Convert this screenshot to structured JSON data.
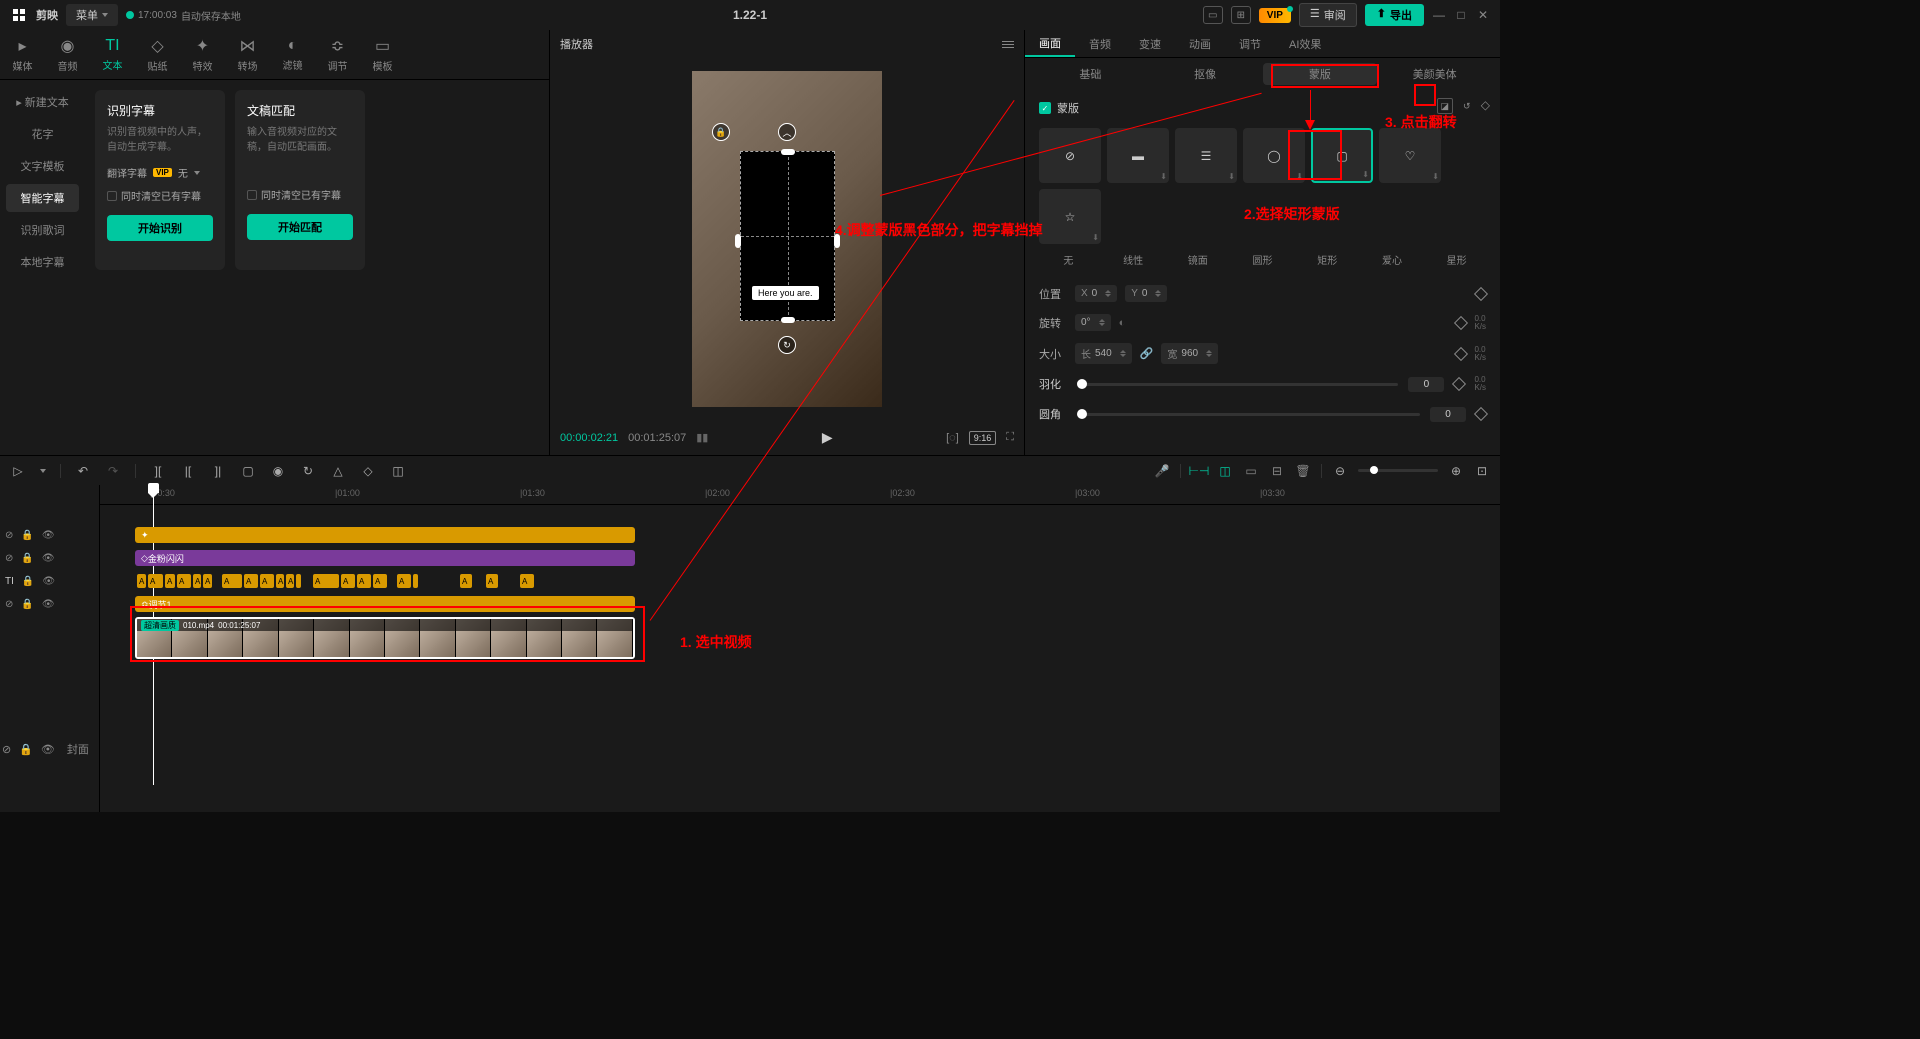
{
  "titlebar": {
    "app": "剪映",
    "menu": "菜单",
    "autosave_time": "17:00:03",
    "autosave_label": "自动保存本地",
    "project": "1.22-1",
    "vip": "VIP",
    "review": "审阅",
    "export": "导出"
  },
  "top_tabs": [
    "媒体",
    "音频",
    "文本",
    "贴纸",
    "特效",
    "转场",
    "滤镜",
    "调节",
    "模板"
  ],
  "top_tab_labels_en": [
    "TI"
  ],
  "left_sidebar": [
    "新建文本",
    "花字",
    "文字模板",
    "智能字幕",
    "识别歌词",
    "本地字幕"
  ],
  "cards": {
    "a": {
      "title": "识别字幕",
      "desc": "识别音视频中的人声，自动生成字幕。",
      "translate_label": "翻译字幕",
      "translate_value": "无",
      "clear": "同时清空已有字幕",
      "btn": "开始识别"
    },
    "b": {
      "title": "文稿匹配",
      "desc": "输入音视频对应的文稿，自动匹配画面。",
      "clear": "同时清空已有字幕",
      "btn": "开始匹配"
    }
  },
  "preview": {
    "header": "播放器",
    "subtitle": "Here you are.",
    "time_current": "00:00:02:21",
    "time_total": "00:01:25:07",
    "ratio": "9:16"
  },
  "right_tabs": [
    "画面",
    "音频",
    "变速",
    "动画",
    "调节",
    "AI效果"
  ],
  "sub_tabs": [
    "基础",
    "抠像",
    "蒙版",
    "美颜美体"
  ],
  "mask": {
    "label": "蒙版",
    "shapes": [
      "无",
      "线性",
      "镜面",
      "圆形",
      "矩形",
      "爱心",
      "星形"
    ],
    "position_label": "位置",
    "position_x": "0",
    "position_y": "0",
    "rotate_label": "旋转",
    "rotate_val": "0°",
    "size_label": "大小",
    "size_w_label": "长",
    "size_w": "540",
    "size_h_label": "宽",
    "size_h": "960",
    "feather_label": "羽化",
    "feather_val": "0",
    "corner_label": "圆角",
    "corner_val": "0",
    "kfs": "0.0\nK/s"
  },
  "ruler": [
    "|00:30",
    "|01:00",
    "|01:30",
    "|02:00",
    "|02:30",
    "|03:00",
    "|03:30"
  ],
  "tracks": {
    "purple": "金粉闪闪",
    "yellow2": "调节1",
    "video_fx": "超清画质",
    "video_name": "010.mp4",
    "video_dur": "00:01:25:07",
    "cover": "封面"
  },
  "annotations": {
    "a1": "1. 选中视频",
    "a2": "2.选择矩形蒙版",
    "a3": "3. 点击翻转",
    "a4": "4.调整蒙版黑色部分，把字幕挡掉"
  }
}
